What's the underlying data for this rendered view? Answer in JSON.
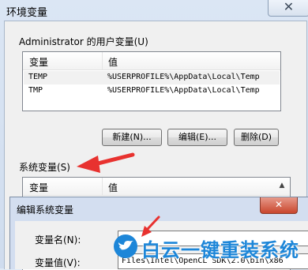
{
  "window": {
    "title": "环境变量",
    "close_glyph": "✕"
  },
  "user_vars": {
    "group_label": "Administrator 的用户变量(U)",
    "col_variable": "变量",
    "col_value": "值",
    "rows": [
      {
        "name": "TEMP",
        "value": "%USERPROFILE%\\AppData\\Local\\Temp"
      },
      {
        "name": "TMP",
        "value": "%USERPROFILE%\\AppData\\Local\\Temp"
      }
    ],
    "btn_new": "新建(N)...",
    "btn_edit": "编辑(E)...",
    "btn_delete": "删除(D)"
  },
  "system_vars": {
    "group_label": "系统变量(S)",
    "col_variable": "变量",
    "col_value": "值"
  },
  "edit_dialog": {
    "title": "编辑系统变量",
    "close_glyph": "✕",
    "name_label": "变量名(N):",
    "value_label": "变量值(V):",
    "value_text": "Files\\Intel\\OpenCL SDK\\2.0\\bin\\x86"
  },
  "watermark": {
    "text": "白云一键重装系统"
  },
  "colors": {
    "accent_red": "#e8322f",
    "watermark_blue": "#1d86d8"
  }
}
